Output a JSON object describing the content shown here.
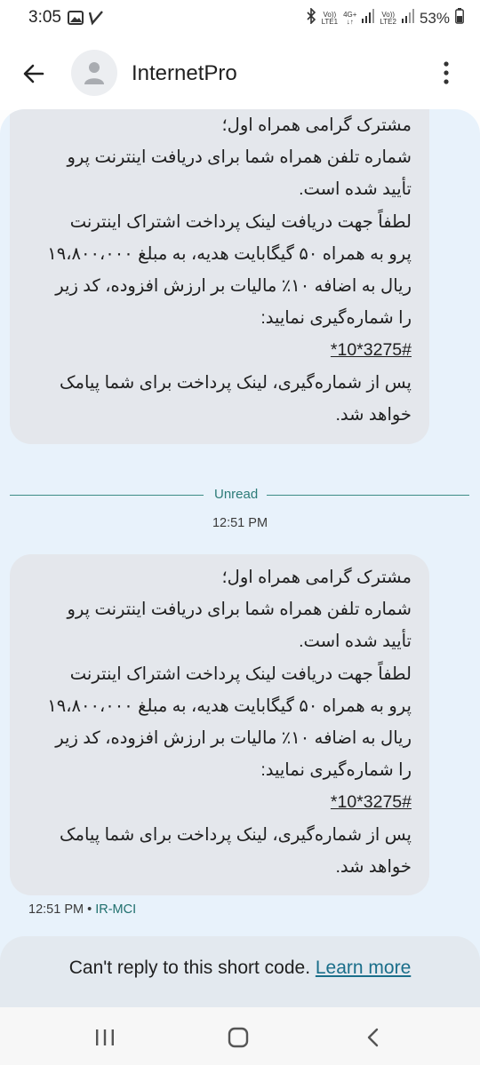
{
  "status_bar": {
    "time": "3:05",
    "sim1_top": "Vo))",
    "sim1_bottom": "LTE1",
    "net_top": "4G+",
    "sim2_top": "Vo))",
    "sim2_bottom": "LTE2",
    "battery": "53%"
  },
  "header": {
    "title": "InternetPro"
  },
  "messages": [
    {
      "lines": [
        "مشترک گرامی همراه اول؛",
        "شماره تلفن همراه شما برای دریافت اینترنت پرو",
        "تأیید شده است.",
        "لطفاً جهت دریافت لینک پرداخت اشتراک اینترنت",
        "پرو به همراه ۵۰ گیگابایت هدیه، به مبلغ ۱۹،۸۰۰،۰۰۰",
        "ریال به اضافه ۱۰٪ مالیات بر ارزش افزوده، کد زیر",
        "را شماره‌گیری نمایید:",
        "*10*3275#",
        "پس از شماره‌گیری، لینک پرداخت برای شما پیامک",
        "خواهد شد."
      ]
    },
    {
      "lines": [
        "مشترک گرامی همراه اول؛",
        "شماره تلفن همراه شما برای دریافت اینترنت پرو",
        "تأیید شده است.",
        "لطفاً جهت دریافت لینک پرداخت اشتراک اینترنت",
        "پرو به همراه ۵۰ گیگابایت هدیه، به مبلغ ۱۹،۸۰۰،۰۰۰",
        "ریال به اضافه ۱۰٪ مالیات بر ارزش افزوده، کد زیر",
        "را شماره‌گیری نمایید:",
        "*10*3275#",
        "پس از شماره‌گیری، لینک پرداخت برای شما پیامک",
        "خواهد شد."
      ],
      "time": "12:51 PM",
      "separator": "•",
      "sender": "IR-MCI"
    }
  ],
  "unread_label": "Unread",
  "time_separator": "12:51 PM",
  "reply": {
    "text": "Can't reply to this short code.",
    "link": "Learn more"
  },
  "colors": {
    "conversation_bg": "#e8f2fb",
    "bubble_bg": "#e4e7ec",
    "accent_teal": "#2d7c78",
    "link": "#1a6e8a"
  },
  "icons": [
    "image-icon",
    "check-icon",
    "bluetooth-icon",
    "signal-icon",
    "battery-icon",
    "back-arrow-icon",
    "person-icon",
    "more-vert-icon",
    "recents-icon",
    "home-icon",
    "back-nav-icon"
  ]
}
